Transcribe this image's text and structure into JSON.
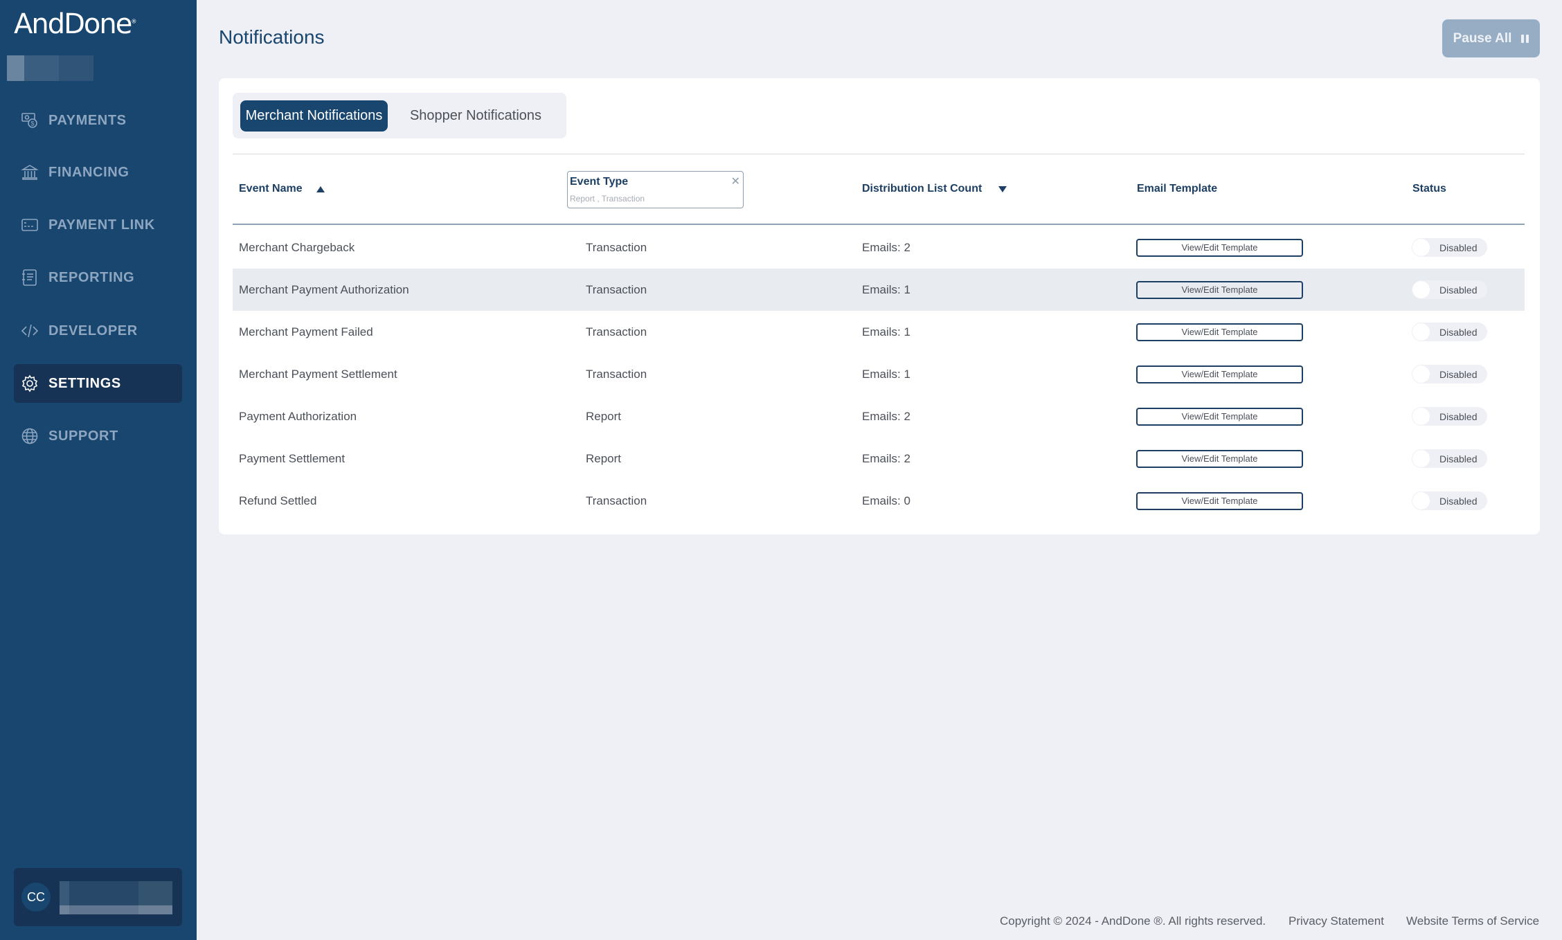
{
  "brand": {
    "logo_text": "AndDone",
    "logo_mark": "®"
  },
  "sidebar": {
    "items": [
      {
        "label": "PAYMENTS",
        "icon": "payments-icon",
        "active": false
      },
      {
        "label": "FINANCING",
        "icon": "bank-icon",
        "active": false
      },
      {
        "label": "PAYMENT LINK",
        "icon": "payment-link-icon",
        "active": false
      },
      {
        "label": "REPORTING",
        "icon": "report-icon",
        "active": false
      },
      {
        "label": "DEVELOPER",
        "icon": "code-icon",
        "active": false
      },
      {
        "label": "SETTINGS",
        "icon": "gear-icon",
        "active": true
      },
      {
        "label": "SUPPORT",
        "icon": "globe-icon",
        "active": false
      }
    ],
    "user": {
      "initials": "CC"
    }
  },
  "header": {
    "title": "Notifications",
    "pause_all_label": "Pause All"
  },
  "tabs": [
    {
      "label": "Merchant Notifications",
      "active": true
    },
    {
      "label": "Shopper Notifications",
      "active": false
    }
  ],
  "table": {
    "columns": {
      "event_name": "Event Name",
      "event_type": "Event Type",
      "event_type_filter_value": "Report , Transaction",
      "distribution_list_count": "Distribution List Count",
      "email_template": "Email Template",
      "status": "Status"
    },
    "sort": {
      "event_name": "ascending",
      "distribution_list_count": "descending"
    },
    "rows": [
      {
        "name": "Merchant Chargeback",
        "type": "Transaction",
        "dist": "Emails: 2",
        "template_label": "View/Edit Template",
        "status": "Disabled"
      },
      {
        "name": "Merchant Payment Authorization",
        "type": "Transaction",
        "dist": "Emails: 1",
        "template_label": "View/Edit Template",
        "status": "Disabled"
      },
      {
        "name": "Merchant Payment Failed",
        "type": "Transaction",
        "dist": "Emails: 1",
        "template_label": "View/Edit Template",
        "status": "Disabled"
      },
      {
        "name": "Merchant Payment Settlement",
        "type": "Transaction",
        "dist": "Emails: 1",
        "template_label": "View/Edit Template",
        "status": "Disabled"
      },
      {
        "name": "Payment Authorization",
        "type": "Report",
        "dist": "Emails: 2",
        "template_label": "View/Edit Template",
        "status": "Disabled"
      },
      {
        "name": "Payment Settlement",
        "type": "Report",
        "dist": "Emails: 2",
        "template_label": "View/Edit Template",
        "status": "Disabled"
      },
      {
        "name": "Refund Settled",
        "type": "Transaction",
        "dist": "Emails: 0",
        "template_label": "View/Edit Template",
        "status": "Disabled"
      }
    ]
  },
  "footer": {
    "copyright": "Copyright © 2024 - AndDone ®. All rights reserved.",
    "privacy": "Privacy Statement",
    "terms": "Website Terms of Service"
  },
  "colors": {
    "sidebar_bg": "#18466f",
    "sidebar_active": "#163355",
    "accent": "#18466f",
    "page_bg": "#eff0f5",
    "pause_button": "#97adc4"
  }
}
